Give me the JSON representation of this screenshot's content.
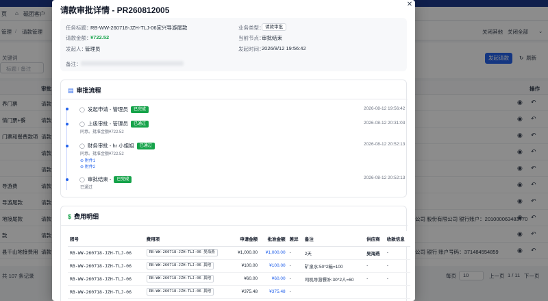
{
  "background": {
    "tabs": [
      "页",
      "磁团客户"
    ],
    "breadcrumb": [
      "管理",
      "请款管理"
    ],
    "top_actions": [
      "关闭其他",
      "关闭全部"
    ],
    "filter_label": "关键词",
    "filter_placeholder": "标题 / 备注",
    "new_button": "发起请款",
    "refresh_button": "刷新",
    "table_headers": {
      "col1": "",
      "col2": "审批",
      "ops": "操作"
    },
    "rows": [
      {
        "c1": "界门票",
        "c2": "请款"
      },
      {
        "c1": "情门票+餐",
        "c2": "请款"
      },
      {
        "c1": "门票和餐费款项",
        "c2": "请款"
      },
      {
        "c1": "",
        "c2": "请款"
      },
      {
        "c1": "",
        "c2": "请款"
      },
      {
        "c1": "导游费",
        "c2": "请款"
      },
      {
        "c1": "导游尾款",
        "c2": "请款"
      },
      {
        "c1": "地接尾款",
        "c2": "请款",
        "right": "公司 股份有限公司 银行账户：201000063483770"
      },
      {
        "c1": "款",
        "c2": "请款"
      },
      {
        "c1": "县千山地接费用",
        "c2": "请款",
        "right": "公司 银行 账户号码：371484554859"
      }
    ],
    "footer": {
      "total": "共 107 条记录",
      "per_page_label": "每页",
      "per_page": "10",
      "prev": "上一页",
      "pages": "1 / 11",
      "next": "下一页"
    }
  },
  "modal": {
    "title": "请款审批详情 - PR260812005",
    "close_icon": "close-icon",
    "info": {
      "task_title_label": "任务标题：",
      "task_title": "RB-WW-260718-JZH-TLJ-06宜兴导游尾款",
      "business_type_label": "业务类型：",
      "business_type": "请款审批",
      "amount_label": "请款金额：",
      "amount": "¥722.52",
      "current_node_label": "当前节点：",
      "current_node": "审批结束",
      "initiator_label": "发起人：",
      "initiator": "管理员",
      "start_time_label": "发起时间：",
      "start_time": "2026/8/12 19:56:42",
      "remark_label": "备注："
    },
    "flow": {
      "title": "审批流程",
      "steps": [
        {
          "title": "发起申请 - 管理员",
          "badge": "已完成",
          "time": "2026-08-12 19:56:42",
          "sub": "",
          "attachments": []
        },
        {
          "title": "上级审批 - 管理员",
          "badge": "已通过",
          "time": "2026-08-12 20:31:03",
          "sub": "同意。批准金额¥722.52",
          "attachments": []
        },
        {
          "title": "财务审批 - hr 小姐姐",
          "badge": "已通过",
          "time": "2026-08-12 20:52:13",
          "sub": "同意。批准金额¥722.52",
          "attachments": [
            "附件1",
            "附件2"
          ]
        },
        {
          "title": "审批结束 -",
          "badge": "已完成",
          "time": "2026-08-12 20:52:13",
          "sub": "已通过",
          "attachments": []
        }
      ]
    },
    "fees": {
      "title": "费用明细",
      "headers": [
        "团号",
        "费用项",
        "申请金额",
        "批准金额",
        "差异",
        "备注",
        "供应商",
        "收款信息"
      ],
      "rows": [
        {
          "group": "RB-WW-260718-JZH-TLJ-06",
          "item": "RB-WW-260718-JZH-TLJ-06 吴海燕",
          "apply": "¥1,000.00",
          "approve": "¥1,000.00",
          "diff": "-",
          "remark": "2天",
          "supplier": "吴海燕",
          "pay": "-"
        },
        {
          "group": "RB-WW-260718-JZH-TLJ-06",
          "item": "RB-WW-260718-JZH-TLJ-06 其他",
          "apply": "¥100.00",
          "approve": "¥100.00",
          "diff": "-",
          "remark": "矿泉水:50*2箱=100",
          "supplier": "-",
          "pay": "-"
        },
        {
          "group": "RB-WW-260718-JZH-TLJ-06",
          "item": "RB-WW-260718-JZH-TLJ-06 其他",
          "apply": "¥60.00",
          "approve": "¥60.00",
          "diff": "-",
          "remark": "司机导游餐补:30*2人=60",
          "supplier": "-",
          "pay": "-"
        },
        {
          "group": "RB-WW-260718-JZH-TLJ-06",
          "item": "RB-WW-260718-JZH-TLJ-06 其他",
          "apply": "¥375.48",
          "approve": "¥375.48",
          "diff": "-",
          "remark": "",
          "supplier": "",
          "pay": ""
        }
      ]
    }
  }
}
